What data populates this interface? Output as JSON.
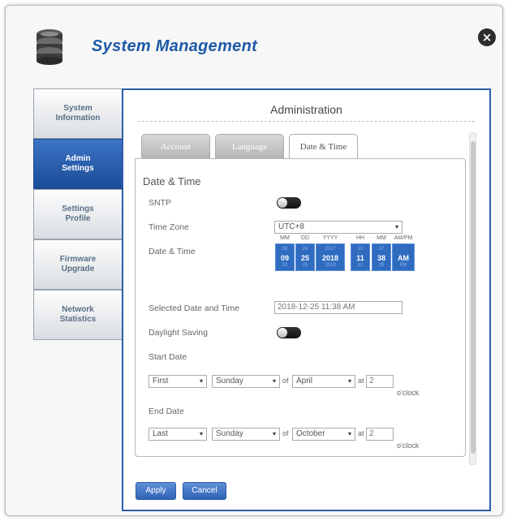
{
  "window": {
    "title": "System Management"
  },
  "sidebar": {
    "items": [
      {
        "label": "System Information"
      },
      {
        "label": "Admin Settings"
      },
      {
        "label": "Settings Profile"
      },
      {
        "label": "Firmware Upgrade"
      },
      {
        "label": "Network Statistics"
      }
    ]
  },
  "panel": {
    "title": "Administration"
  },
  "tabs": [
    {
      "label": "Account"
    },
    {
      "label": "Language"
    },
    {
      "label": "Date & Time"
    }
  ],
  "datetime": {
    "section_title": "Date & Time",
    "sntp_label": "SNTP",
    "timezone_label": "Time Zone",
    "timezone_value": "UTC+8",
    "datetime_label": "Date & Time",
    "picker": {
      "headers": {
        "mm": "MM",
        "dd": "DD",
        "yyyy": "YYYY",
        "hh": "HH",
        "min": "MM",
        "ampm": "AM/PM"
      },
      "month": "09",
      "day": "25",
      "year": "2018",
      "hour": "11",
      "minute": "38",
      "ampm": "AM"
    },
    "selected_label": "Selected Date and Time",
    "selected_value": "2018-12-25 11:38 AM",
    "daylight_label": "Daylight Saving",
    "start_label": "Start Date",
    "start": {
      "week": "First",
      "day": "Sunday",
      "of": "of",
      "month": "April",
      "at": "at",
      "hour": "2",
      "oclock": "o'clock"
    },
    "end_label": "End Date",
    "end": {
      "week": "Last",
      "day": "Sunday",
      "of": "of",
      "month": "October",
      "at": "at",
      "hour": "2",
      "oclock": "o'clock"
    }
  },
  "buttons": {
    "apply": "Apply",
    "cancel": "Cancel"
  },
  "colors": {
    "accent": "#2e5da8",
    "active_nav": "#1a4c97",
    "picker_blue": "#2f6cc0"
  }
}
